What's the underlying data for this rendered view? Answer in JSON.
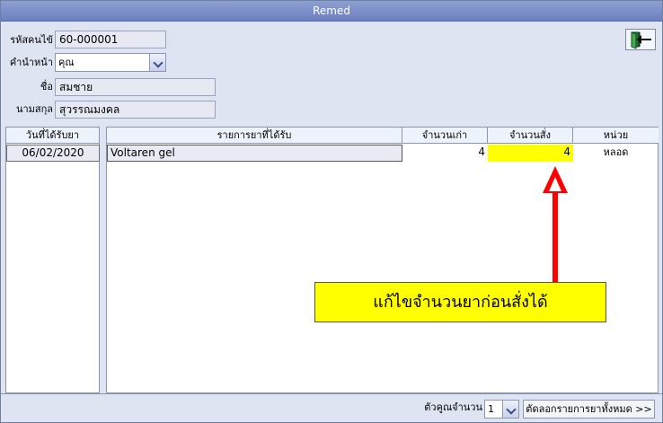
{
  "window": {
    "title": "Remed"
  },
  "form": {
    "user_code_label": "รหัสคนไข้",
    "user_code_value": "60-000001",
    "prefix_label": "คำนำหน้า",
    "prefix_value": "คุณ",
    "first_name_label": "ชื่อ",
    "first_name_value": "สมชาย",
    "last_name_label": "นามสกุล",
    "last_name_value": "สุวรรณมงคล"
  },
  "dates_table": {
    "header": "วันที่ได้รับยา",
    "rows": [
      "06/02/2020"
    ]
  },
  "drugs_table": {
    "headers": [
      "รายการยาที่ได้รับ",
      "จำนวนเก่า",
      "จำนวนสั่ง",
      "หน่วย"
    ],
    "rows": [
      {
        "name": "Voltaren gel",
        "old_qty": "4",
        "order_qty": "4",
        "unit": "หลอด"
      }
    ]
  },
  "footer": {
    "multiplier_label": "ตัวคูณจำนวน",
    "multiplier_value": "1",
    "cut_all_button": "ตัดลอกรายการยาทั้งหมด >>"
  },
  "annotation": {
    "callout_text": "แก้ไขจำนวนยาก่อนสั่งได้",
    "color": "#ffff00",
    "arrow_color": "#ff0000"
  },
  "icons": {
    "exit": "exit-door-icon",
    "dropdown": "chevron-down-icon"
  }
}
